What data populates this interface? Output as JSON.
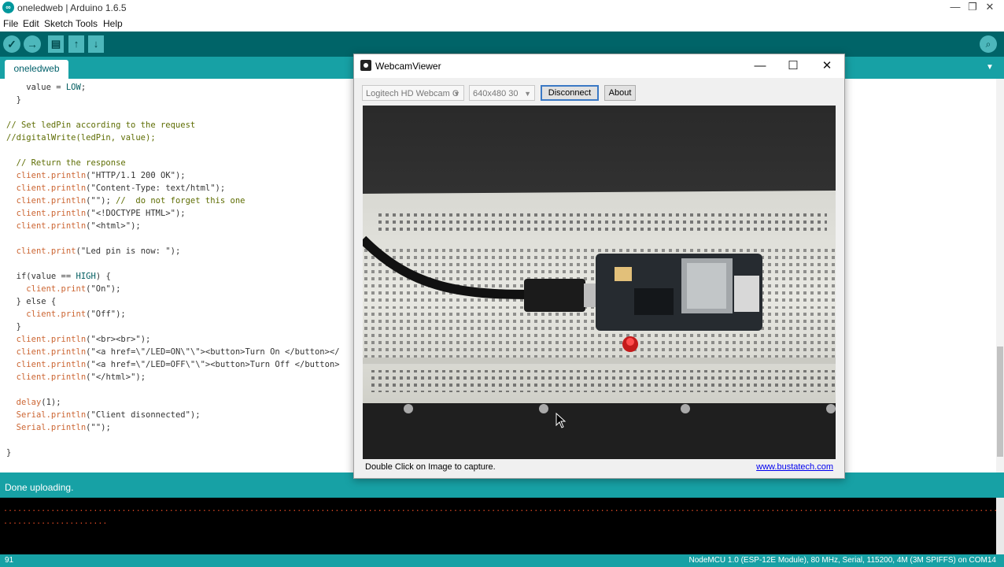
{
  "window": {
    "title": "oneledweb | Arduino 1.6.5",
    "app_icon_text": "∞",
    "controls": {
      "minimize": "—",
      "restore": "❐",
      "close": "✕"
    }
  },
  "menu": {
    "items": [
      "File",
      "Edit",
      "Sketch",
      "Tools",
      "Help"
    ]
  },
  "toolbar": {
    "verify_icon": "✓",
    "upload_icon": "→",
    "new_icon": "▤",
    "open_icon": "↑",
    "save_icon": "↓",
    "serial_monitor_icon": "⌕"
  },
  "tabs": {
    "active": "oneledweb",
    "menu_icon": "▼"
  },
  "editor": {
    "lines": [
      "    value = LOW;",
      "  }",
      "",
      "// Set ledPin according to the request",
      "//digitalWrite(ledPin, value);",
      "",
      "  // Return the response",
      "  client.println(\"HTTP/1.1 200 OK\");",
      "  client.println(\"Content-Type: text/html\");",
      "  client.println(\"\"); //  do not forget this one",
      "  client.println(\"<!DOCTYPE HTML>\");",
      "  client.println(\"<html>\");",
      "",
      "  client.print(\"Led pin is now: \");",
      "",
      "  if(value == HIGH) {",
      "    client.print(\"On\");",
      "  } else {",
      "    client.print(\"Off\");",
      "  }",
      "  client.println(\"<br><br>\");",
      "  client.println(\"<a href=\\\"/LED=ON\\\"\\\"><button>Turn On </button></",
      "  client.println(\"<a href=\\\"/LED=OFF\\\"\\\"><button>Turn Off </button>",
      "  client.println(\"</html>\");",
      "",
      "  delay(1);",
      "  Serial.println(\"Client disonnected\");",
      "  Serial.println(\"\");",
      "",
      "}"
    ]
  },
  "status": {
    "message": "Done uploading."
  },
  "console": {
    "lines": [
      "................................................................................................................................................................................................................................................",
      "......................"
    ]
  },
  "footer": {
    "line_number": "91",
    "board_info": "NodeMCU 1.0 (ESP-12E Module), 80 MHz, Serial, 115200, 4M (3M SPIFFS) on COM14"
  },
  "webcam_viewer": {
    "title": "WebcamViewer",
    "controls": {
      "minimize": "—",
      "maximize": "☐",
      "close": "✕"
    },
    "device_select": "Logitech HD Webcam C",
    "resolution_select": "640x480 30",
    "disconnect_label": "Disconnect",
    "about_label": "About",
    "caption": "Double Click on Image to capture.",
    "link": "www.bustatech.com"
  },
  "colors": {
    "toolbar": "#006468",
    "tabbar": "#17a1a5",
    "keyword": "#cc6633",
    "console_text": "#e34c26"
  }
}
